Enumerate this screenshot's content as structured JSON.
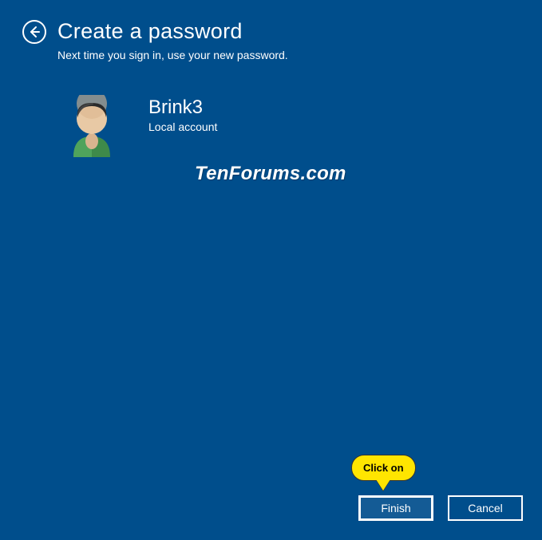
{
  "header": {
    "title": "Create a password",
    "subtitle": "Next time you sign in, use your new password."
  },
  "account": {
    "name": "Brink3",
    "type": "Local account"
  },
  "watermark": "TenForums.com",
  "callout": "Click on",
  "buttons": {
    "finish": "Finish",
    "cancel": "Cancel"
  }
}
